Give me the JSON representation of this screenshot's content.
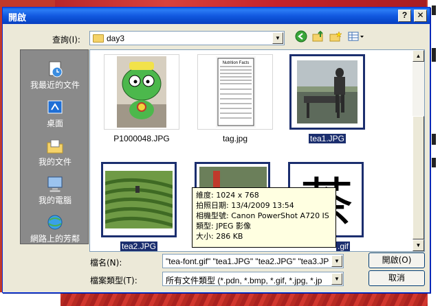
{
  "dialog": {
    "title": "開啟",
    "help_button": "?",
    "close_button": "✕"
  },
  "lookin": {
    "label": "查詢(I):",
    "value": "day3"
  },
  "toolbar": {
    "back_icon": "back-arrow-icon",
    "up_icon": "up-folder-icon",
    "new_folder_icon": "new-folder-icon",
    "views_icon": "views-menu-icon"
  },
  "places": [
    {
      "label": "我最近的文件",
      "icon": "recent-documents-icon"
    },
    {
      "label": "桌面",
      "icon": "desktop-icon"
    },
    {
      "label": "我的文件",
      "icon": "my-documents-icon"
    },
    {
      "label": "我的電腦",
      "icon": "my-computer-icon"
    },
    {
      "label": "網路上的芳鄰",
      "icon": "network-places-icon"
    }
  ],
  "files": [
    {
      "name": "P1000048.JPG",
      "selected": false
    },
    {
      "name": "tag.jpg",
      "selected": false
    },
    {
      "name": "tea1.JPG",
      "selected": true
    },
    {
      "name": "tea2.JPG",
      "selected": true
    },
    {
      "name": "",
      "selected": false
    },
    {
      "name": ".gif",
      "selected": true
    }
  ],
  "thumb_text": {
    "nutrition": "Nutrition Facts",
    "char": "茶"
  },
  "tooltip": {
    "line1": "維度: 1024 x 768",
    "line2": "拍照日期: 13/4/2009 13:54",
    "line3": "相機型號: Canon PowerShot A720 IS",
    "line4": "類型: JPEG 影像",
    "line5": "大小: 286 KB"
  },
  "filename": {
    "label": "檔名(N):",
    "value": "\"tea-font.gif\" \"tea1.JPG\" \"tea2.JPG\" \"tea3.JPG\""
  },
  "filetype": {
    "label": "檔案類型(T):",
    "value": "所有文件類型 (*.pdn, *.bmp, *.gif, *.jpg, *.jp"
  },
  "buttons": {
    "open": "開啟(O)",
    "cancel": "取消"
  }
}
